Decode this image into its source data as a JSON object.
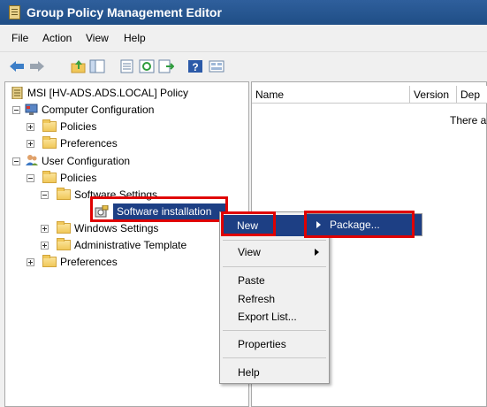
{
  "window": {
    "title": "Group Policy Management Editor"
  },
  "menu": [
    "File",
    "Action",
    "View",
    "Help"
  ],
  "list": {
    "columns": [
      "Name",
      "Version",
      "Dep"
    ],
    "empty_text": "There a"
  },
  "tree": {
    "root": "MSI [HV-ADS.ADS.LOCAL] Policy",
    "computer_config": "Computer Configuration",
    "cc_policies": "Policies",
    "cc_preferences": "Preferences",
    "user_config": "User Configuration",
    "uc_policies": "Policies",
    "software_settings": "Software Settings",
    "software_installation": "Software installation",
    "windows_settings": "Windows Settings",
    "admin_templates": "Administrative Template",
    "uc_preferences": "Preferences"
  },
  "context_menu": {
    "new": "New",
    "view": "View",
    "paste": "Paste",
    "refresh": "Refresh",
    "export_list": "Export List...",
    "properties": "Properties",
    "help": "Help"
  },
  "submenu": {
    "package": "Package..."
  },
  "colors": {
    "selection": "#1d3f84",
    "highlight_box": "#e00000",
    "title_bar": "#2f5f9c"
  }
}
